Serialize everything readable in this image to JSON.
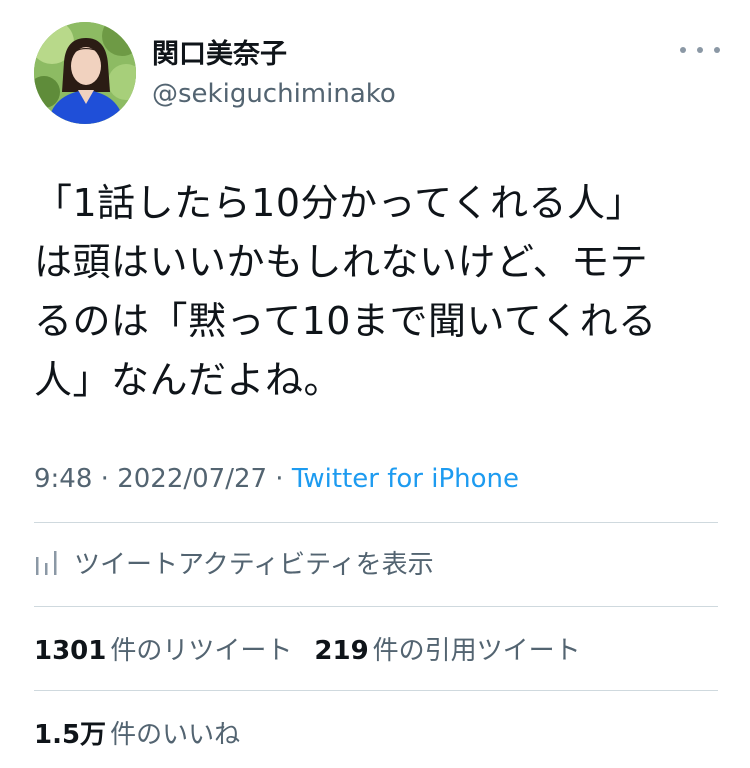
{
  "author": {
    "name": "関口美奈子",
    "handle": "@sekiguchiminako"
  },
  "tweet": {
    "lines": [
      "「1話したら10分かってくれる人」",
      "は頭はいいかもしれないけど、モテ",
      "るのは「黙って10まで聞いてくれる",
      "人」なんだよね。"
    ]
  },
  "meta": {
    "time": "9:48",
    "sep1": " · ",
    "date": "2022/07/27",
    "sep2": " · ",
    "source": "Twitter for iPhone"
  },
  "activity": {
    "label": "ツイートアクティビティを表示"
  },
  "stats": {
    "retweets": {
      "count": "1301",
      "label": "件のリツイート"
    },
    "quotes": {
      "count": "219",
      "label": "件の引用ツイート"
    },
    "likes": {
      "count": "1.5万",
      "label": "件のいいね"
    }
  },
  "colors": {
    "text": "#0f1419",
    "secondary": "#536471",
    "link": "#1d9bf0",
    "divider": "#cfd9de"
  }
}
